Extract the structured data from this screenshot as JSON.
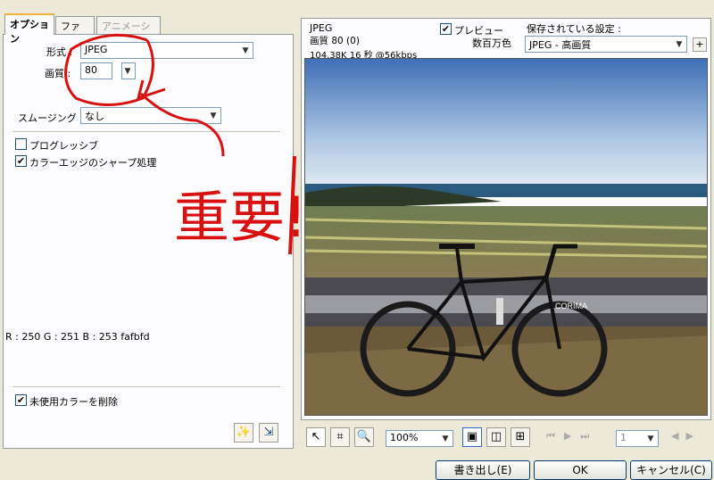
{
  "tabs": [
    "オプション",
    "ファイル",
    "アニメーション"
  ],
  "format": {
    "label": "形式 :",
    "value": "JPEG"
  },
  "quality": {
    "label": "画質 :",
    "value": "80"
  },
  "smoothing": {
    "label": "スムージング :",
    "value": "なし"
  },
  "progressive": {
    "label": "プログレッシブ",
    "checked": false
  },
  "sharpen": {
    "label": "カラーエッジのシャープ処理",
    "checked": true
  },
  "rgb_readout": "R : 250 G : 251 B : 253 fafbfd",
  "remove_unused": {
    "label": "未使用カラーを削除",
    "checked": true
  },
  "annotation": "重要!",
  "preview_info": {
    "format": "JPEG",
    "quality_line": "画質 80 (0)",
    "size_line": "104.38K  16 秒 @56kbps",
    "preview_label": "プレビュー",
    "colors": "数百万色"
  },
  "saved_settings": {
    "label": "保存されている設定 :",
    "value": "JPEG - 高画質"
  },
  "zoom": "100%",
  "frame": "1",
  "buttons": {
    "export": "書き出し(E)",
    "ok": "OK",
    "cancel": "キャンセル(C)"
  },
  "photo_text": "CORIMA"
}
